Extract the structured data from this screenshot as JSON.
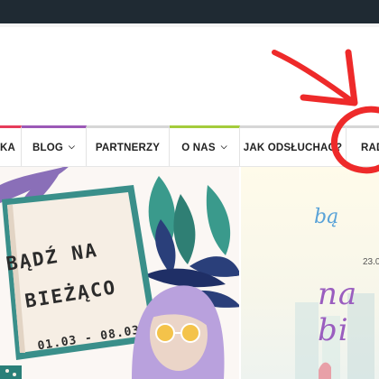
{
  "nav": {
    "items": [
      {
        "label": "KA",
        "has_dropdown": false,
        "accent": "#e63c5a"
      },
      {
        "label": "BLOG",
        "has_dropdown": true,
        "accent": "#9b59b6"
      },
      {
        "label": "PARTNERZY",
        "has_dropdown": false,
        "accent": "#d6d6d6"
      },
      {
        "label": "O NAS",
        "has_dropdown": true,
        "accent": "#a4cc3c"
      },
      {
        "label": "JAK ODSŁUCHAĆ?",
        "has_dropdown": false,
        "accent": "#d6d6d6"
      },
      {
        "label": "RAD",
        "has_dropdown": false,
        "accent": "#d6d6d6"
      }
    ],
    "dropdown_icon": "chevron-down-icon"
  },
  "banner_left": {
    "line1": "BĄDŹ NA",
    "line2": "BIEŻĄCO",
    "dates": "01.03 - 08.03"
  },
  "banner_right": {
    "line1": "bą",
    "date": "23.0",
    "line2": "na bi"
  },
  "annotation": {
    "color": "#ee2a2a",
    "icon": "red-arrow-and-circle-annotation"
  },
  "colors": {
    "topbar": "#1f2a33",
    "book_cover": "#3a8f8a",
    "book_page": "#f6eee4",
    "hair": "#b9a1dd",
    "leaf_dark": "#2a3f7a",
    "leaf_teal": "#3a9a8c"
  }
}
